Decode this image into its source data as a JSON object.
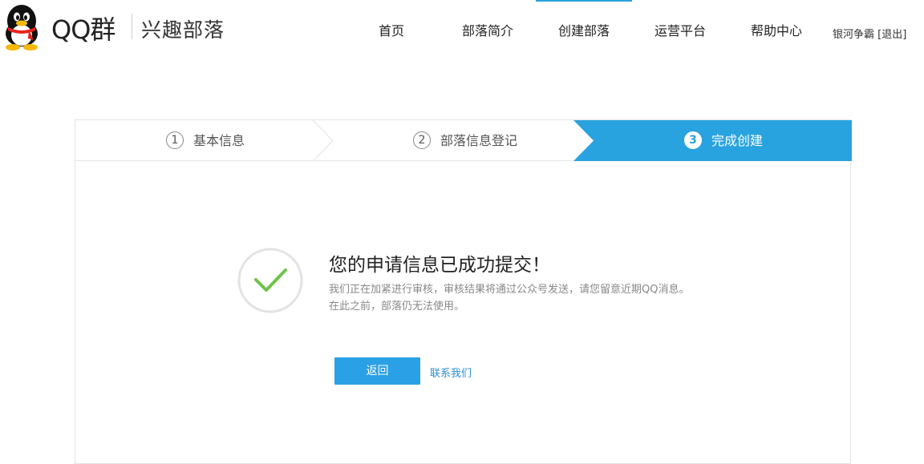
{
  "brand": {
    "name": "QQ群",
    "subtitle": "兴趣部落"
  },
  "nav": {
    "items": [
      {
        "label": "首页"
      },
      {
        "label": "部落简介"
      },
      {
        "label": "创建部落"
      },
      {
        "label": "运营平台"
      },
      {
        "label": "帮助中心"
      }
    ],
    "active_index": 2
  },
  "user": {
    "name": "银河争霸",
    "logout_label": "[退出]"
  },
  "steps": [
    {
      "num": "1",
      "label": "基本信息"
    },
    {
      "num": "2",
      "label": "部落信息登记"
    },
    {
      "num": "3",
      "label": "完成创建"
    }
  ],
  "result": {
    "title": "您的申请信息已成功提交！",
    "line1": "我们正在加紧进行审核，审核结果将通过公众号发送，请您留意近期QQ消息。",
    "line2": "在此之前，部落仍无法使用。"
  },
  "actions": {
    "back_label": "返回",
    "contact_label": "联系我们"
  },
  "colors": {
    "accent": "#29a3df",
    "button": "#2aa0e6",
    "check": "#6dc34a"
  }
}
